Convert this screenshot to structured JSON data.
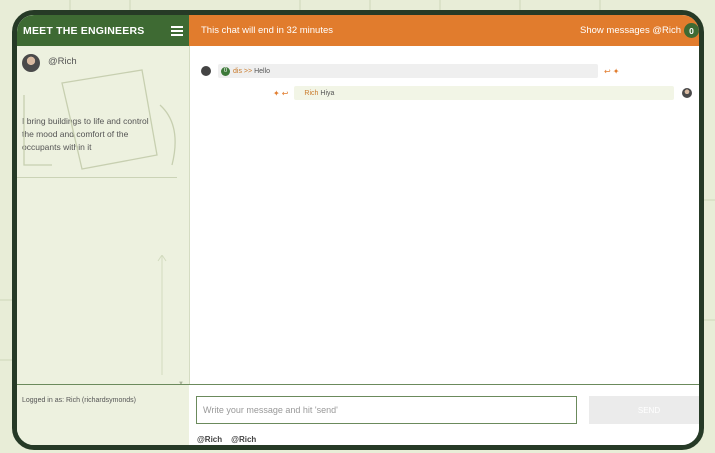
{
  "sidebar": {
    "title": "MEET THE ENGINEERS",
    "profile_name": "@Rich",
    "bio": "I bring buildings to life and control the mood and comfort of the occupants within it",
    "logged_in_text": "Logged in as: Rich (richardsymonds)"
  },
  "topbar": {
    "timer_text": "This chat will end in 32 minutes",
    "show_messages_label": "Show messages @Rich",
    "count": "0"
  },
  "messages": [
    {
      "badge": "0",
      "sender": "dis >>",
      "text": "Hello"
    },
    {
      "sender": "Rich",
      "text": "Hiya"
    }
  ],
  "composer": {
    "placeholder": "Write your message and hit 'send'",
    "send_label": "SEND",
    "mentions": [
      "@Rich",
      "@Rich"
    ]
  },
  "colors": {
    "brand_green": "#3e6a33",
    "accent_orange": "#e17c2d",
    "frame_dark": "#263a26",
    "sidebar_bg": "#edf1df"
  }
}
